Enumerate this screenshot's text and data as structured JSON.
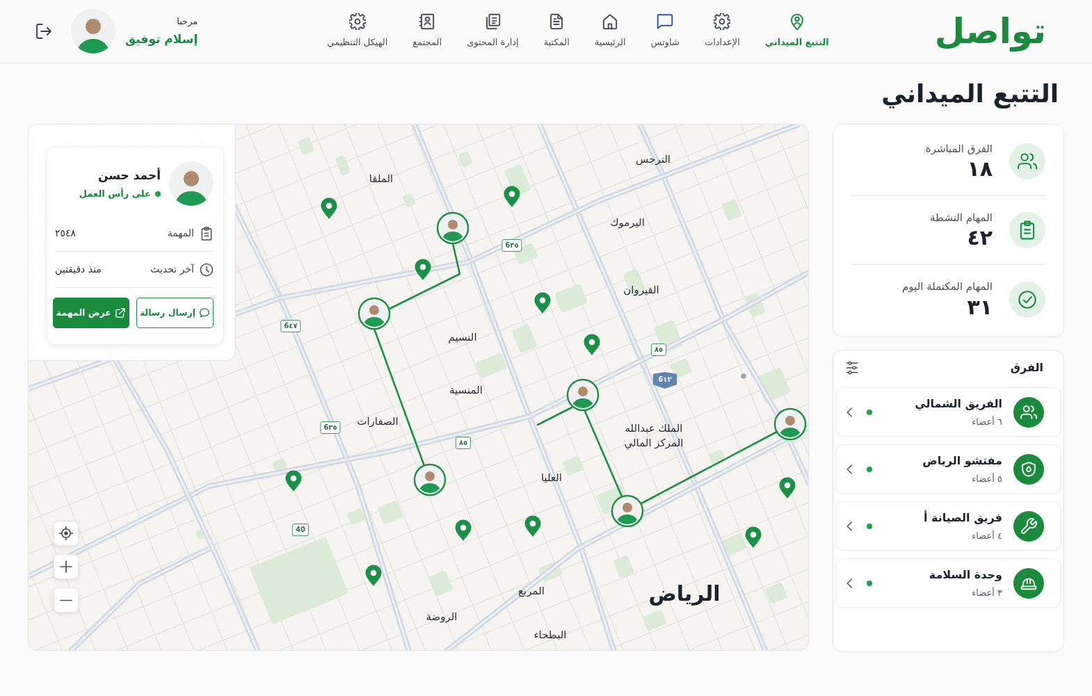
{
  "header": {
    "logo": "تواصل",
    "nav": [
      {
        "label": "التتبع الميداني",
        "selected": true
      },
      {
        "label": "الإعدادات",
        "selected": false
      },
      {
        "label": "شاوتس",
        "selected": false
      },
      {
        "label": "الرئيسية",
        "selected": false
      },
      {
        "label": "المكتبة",
        "selected": false
      },
      {
        "label": "إدارة المحتوى",
        "selected": false
      },
      {
        "label": "المجتمع",
        "selected": false
      },
      {
        "label": "الهيكل التنظيمي",
        "selected": false
      }
    ],
    "user": {
      "greeting": "مرحبا",
      "name": "إسلام توفيق"
    }
  },
  "page_title": "التتبع الميداني",
  "stats": [
    {
      "label": "الفرق المباشرة",
      "value": "١٨"
    },
    {
      "label": "المهام النشطة",
      "value": "٤٢"
    },
    {
      "label": "المهام المكتملة اليوم",
      "value": "٣١"
    }
  ],
  "teams": {
    "title": "الفرق",
    "items": [
      {
        "name": "الفريق الشمالي",
        "members": "٦ أعضاء",
        "active": true
      },
      {
        "name": "مفتشو الرياض",
        "members": "٥ أعضاء",
        "active": true
      },
      {
        "name": "فريق الصيانة أ",
        "members": "٤ أعضاء",
        "active": true
      },
      {
        "name": "وحدة السلامة",
        "members": "٣ أعضاء",
        "active": true
      }
    ]
  },
  "map": {
    "worker_card": {
      "name": "أحمد حسن",
      "status": "على رأس العمل",
      "on_duty": true,
      "rows": [
        {
          "label": "المهمة",
          "value": "٢٥٤٨"
        },
        {
          "label": "آخر تحديث",
          "value": "منذ دقيقتين"
        }
      ],
      "buttons": [
        {
          "label": "إرسال رسالة",
          "kind": "outline"
        },
        {
          "label": "عرض المهمة",
          "kind": "primary"
        }
      ]
    },
    "labels": [
      {
        "text": "النرجس",
        "kind": "district"
      },
      {
        "text": "الملقا",
        "kind": "district"
      },
      {
        "text": "اليرموك",
        "kind": "district"
      },
      {
        "text": "القيروان",
        "kind": "district"
      },
      {
        "text": "النسيم",
        "kind": "district"
      },
      {
        "text": "المنسية",
        "kind": "district"
      },
      {
        "text": "الصفارات",
        "kind": "district"
      },
      {
        "text": "الملك عبدالله",
        "kind": "district"
      },
      {
        "text": "المركز المالي",
        "kind": "district"
      },
      {
        "text": "العليا",
        "kind": "district"
      },
      {
        "text": "المربع",
        "kind": "district"
      },
      {
        "text": "الرياض",
        "kind": "city"
      },
      {
        "text": "الروضة",
        "kind": "district"
      },
      {
        "text": "البطحاء",
        "kind": "district"
      }
    ],
    "shields": [
      {
        "text": "6٣٥",
        "kind": "local"
      },
      {
        "text": "6٤٧",
        "kind": "local"
      },
      {
        "text": "٨٥",
        "kind": "local"
      },
      {
        "text": "6١٢",
        "kind": "highway"
      },
      {
        "text": "6٣٥",
        "kind": "local"
      },
      {
        "text": "٨٥",
        "kind": "local"
      },
      {
        "text": "40",
        "kind": "local"
      }
    ]
  }
}
